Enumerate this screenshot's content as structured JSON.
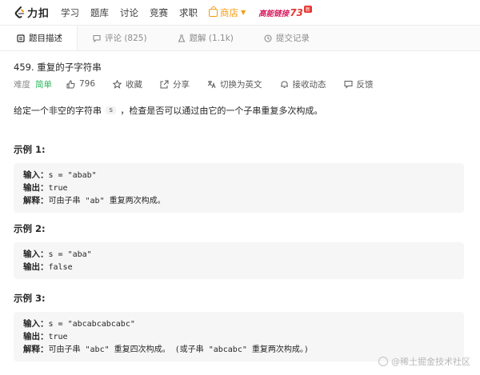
{
  "nav": {
    "logo_text": "力扣",
    "items": [
      "学习",
      "题库",
      "讨论",
      "竞赛",
      "求职"
    ],
    "shop_label": "商店",
    "promo": {
      "text_a": "高能链接",
      "text_b": "73",
      "text_c": "新"
    }
  },
  "tabs": [
    {
      "label": "题目描述"
    },
    {
      "label": "评论 (825)"
    },
    {
      "label": "题解 (1.1k)"
    },
    {
      "label": "提交记录"
    }
  ],
  "problem": {
    "title": "459. 重复的子字符串",
    "difficulty_label": "难度",
    "difficulty": "简单",
    "likes": "796",
    "actions": [
      "收藏",
      "分享",
      "切换为英文",
      "接收动态",
      "反馈"
    ],
    "desc_before": "给定一个非空的字符串",
    "desc_code": "s",
    "desc_after": "，检查是否可以通过由它的一个子串重复多次构成。"
  },
  "examples": [
    {
      "title": "示例 1:",
      "input_label": "输入：",
      "input": "s = \"abab\"",
      "output_label": "输出：",
      "output": "true",
      "explain_label": "解释：",
      "explain": "可由子串 \"ab\" 重复两次构成。"
    },
    {
      "title": "示例 2:",
      "input_label": "输入：",
      "input": "s = \"aba\"",
      "output_label": "输出：",
      "output": "false"
    },
    {
      "title": "示例 3:",
      "input_label": "输入：",
      "input": "s = \"abcabcabcabc\"",
      "output_label": "输出：",
      "output": "true",
      "explain_label": "解释：",
      "explain": "可由子串 \"abc\" 重复四次构成。 (或子串 \"abcabc\" 重复两次构成。)"
    }
  ],
  "watermark": "@稀土掘金技术社区",
  "colors": {
    "accent": "#2db55d",
    "shop": "#f39c12",
    "promo": "#e53935"
  }
}
